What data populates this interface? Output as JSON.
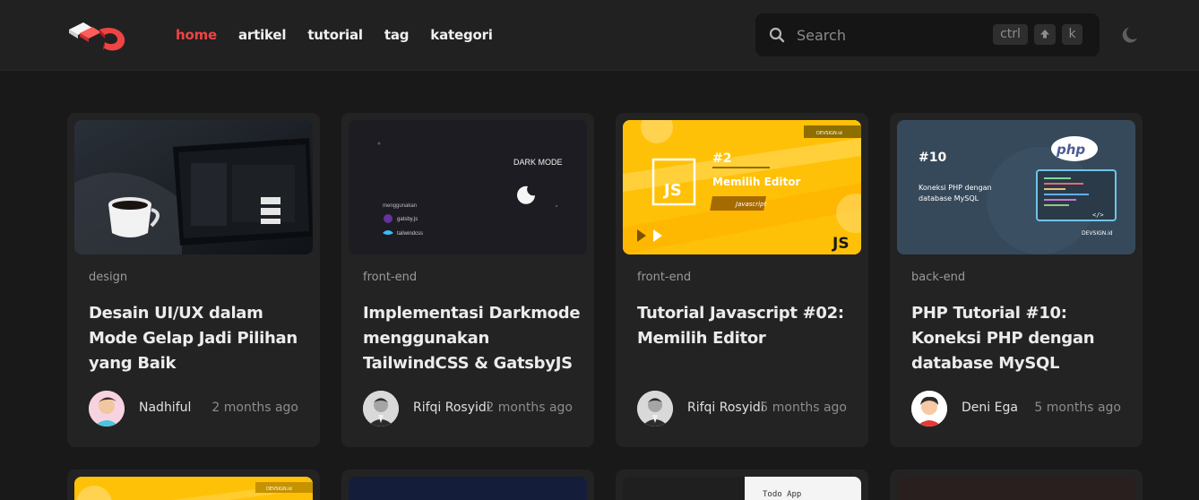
{
  "nav": {
    "items": [
      {
        "label": "home",
        "active": true
      },
      {
        "label": "artikel",
        "active": false
      },
      {
        "label": "tutorial",
        "active": false
      },
      {
        "label": "tag",
        "active": false
      },
      {
        "label": "kategori",
        "active": false
      }
    ],
    "accent": "#ef4444"
  },
  "search": {
    "placeholder": "Search",
    "keys": {
      "ctrl": "ctrl",
      "shift": "⇧",
      "k": "k"
    }
  },
  "icons": {
    "logo": "brand-logo-icon",
    "search": "search-icon",
    "theme": "moon-icon"
  },
  "cards": [
    {
      "category": "design",
      "title": "Desain UI/UX dalam Mode Gelap Jadi Pilihan yang Baik",
      "author": "Nadhiful",
      "time": "2 months ago",
      "thumb_text": {
        "caption": ""
      }
    },
    {
      "category": "front-end",
      "title": "Implementasi Darkmode menggunakan TailwindCSS & GatsbyJS",
      "author": "Rifqi Rosyidi",
      "time": "2 months ago",
      "thumb_text": {
        "heading": "DARK MODE",
        "sub": "menggunakan",
        "item1": "gatsby.js",
        "item2": "tailwindcss"
      }
    },
    {
      "category": "front-end",
      "title": "Tutorial Javascript #02: Memilih Editor",
      "author": "Rifqi Rosyidi",
      "time": "5 months ago",
      "thumb_text": {
        "number": "#2",
        "heading": "Memilih Editor",
        "tag": "Javascript",
        "badge": "JS",
        "brand": "DEVSIGN.id"
      }
    },
    {
      "category": "back-end",
      "title": "PHP Tutorial #10: Koneksi PHP dengan database MySQL",
      "author": "Deni Ega",
      "time": "5 months ago",
      "thumb_text": {
        "number": "#10",
        "heading": "Koneksi PHP dengan database MySQL",
        "logo": "php",
        "brand": "DEVSIGN.id"
      }
    }
  ],
  "second_row": [
    {
      "thumb_text": {
        "brand": "DEVSIGN.id"
      }
    },
    {
      "thumb_text": {}
    },
    {
      "thumb_text": {
        "heading": "Todo App"
      }
    },
    {
      "thumb_text": {}
    }
  ]
}
